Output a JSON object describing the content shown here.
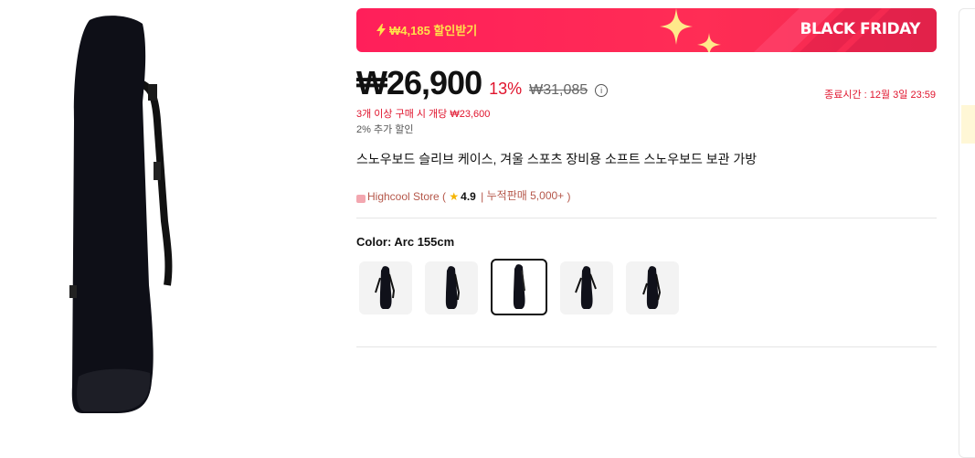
{
  "banner": {
    "coupon_label": "₩4,185 할인받기",
    "event_label": "BLACK FRIDAY"
  },
  "price": {
    "current": "₩26,900",
    "discount": "13%",
    "original": "₩31,085",
    "end_time": "종료시간 : 12월 3일 23:59",
    "bulk": "3개 이상 구매 시 개당 ₩23,600",
    "extra": "2% 추가 할인"
  },
  "product": {
    "title": "스노우보드 슬리브 케이스, 겨울 스포츠 장비용 소프트 스노우보드 보관 가방"
  },
  "store": {
    "name": "Highcool Store",
    "rating": "4.9",
    "sales": "누적판매 5,000+"
  },
  "options": {
    "color_label": "Color: Arc 155cm",
    "swatch_count": 5,
    "selected_index": 2
  },
  "colors": {
    "accent": "#ff2d55",
    "price_red": "#e0142d",
    "coupon_yellow": "#ffe14a"
  }
}
